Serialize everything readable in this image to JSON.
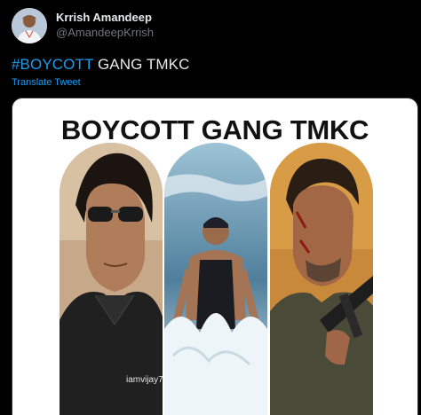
{
  "author": {
    "name": "Krrish Amandeep",
    "handle": "@AmandeepKrrish"
  },
  "tweet": {
    "hashtag": "#BOYCOTT",
    "text_rest": " GANG TMKC",
    "translate_label": "Translate Tweet"
  },
  "media": {
    "poster_title": "BOYCOTT GANG TMKC",
    "watermark": "iamvijay79",
    "panels": [
      "actor-with-sunglasses",
      "actor-running-through-water",
      "bloodied-actor-with-rifle"
    ]
  },
  "colors": {
    "background": "#000000",
    "text_primary": "#e7e9ea",
    "text_secondary": "#71767b",
    "link": "#1d9bf0"
  }
}
